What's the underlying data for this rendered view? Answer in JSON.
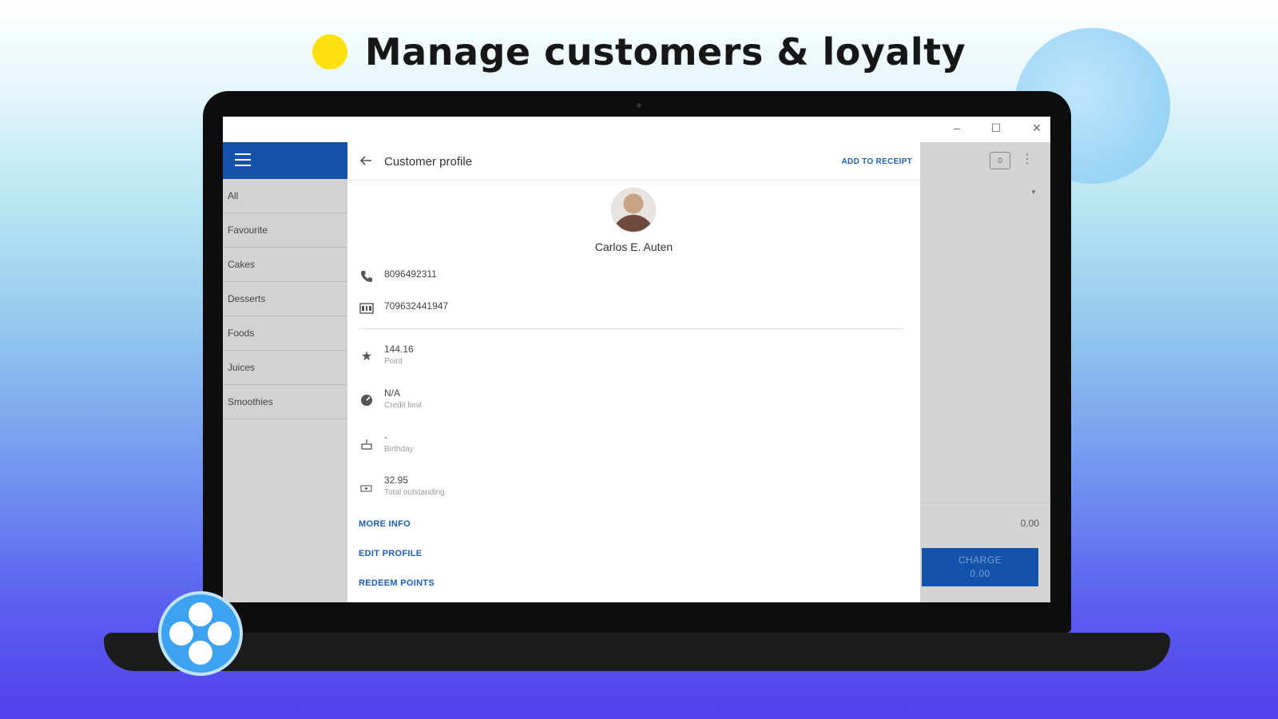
{
  "headline": {
    "text": "Manage customers & loyalty",
    "dot_color": "#fce10f",
    "dot_icon": "yellow-dot"
  },
  "window": {
    "minimize_label": "–",
    "maximize_label": "☐",
    "close_label": "✕"
  },
  "sidebar": {
    "menu_icon": "hamburger-menu-icon",
    "categories": [
      "All",
      "Favourite",
      "Cakes",
      "Desserts",
      "Foods",
      "Juices",
      "Smoothies"
    ]
  },
  "main": {
    "title": "Customer profile",
    "add_to_receipt": "ADD TO RECEIPT",
    "customer_name": "Carlos  E. Auten",
    "phone": "8096492311",
    "card_number": "709632441947",
    "points_value": "144.16",
    "points_label": "Point",
    "credit_value": "N/A",
    "credit_label": "Credit limit",
    "birthday_value": "-",
    "birthday_label": "Birthday",
    "outstanding_value": "32.95",
    "outstanding_label": "Total outstanding",
    "more_info": "MORE INFO",
    "edit_profile": "EDIT PROFILE",
    "redeem_points": "REDEEM POINTS"
  },
  "receipt_panel": {
    "ticket_count": "0",
    "total": "0.00",
    "charge_label": "CHARGE",
    "charge_amount": "0.00"
  },
  "colors": {
    "brand_blue": "#1252a8",
    "link_blue": "#1e5fb8",
    "accent_yellow": "#fce10f",
    "logo_blue": "#3da3f0"
  }
}
